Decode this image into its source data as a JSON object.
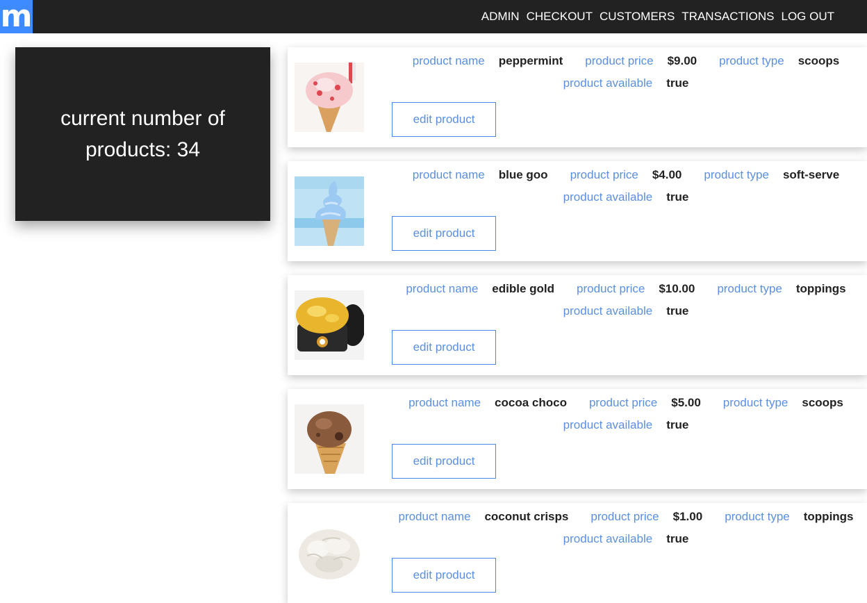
{
  "nav": {
    "logo": "m",
    "links": [
      "ADMIN",
      "CHECKOUT",
      "CUSTOMERS",
      "TRANSACTIONS",
      "LOG OUT"
    ]
  },
  "summary": {
    "text": "current number of products: 34"
  },
  "labels": {
    "name": "product name",
    "price": "product price",
    "type": "product type",
    "available": "product available",
    "edit": "edit product"
  },
  "products": [
    {
      "name": "peppermint",
      "price": "$9.00",
      "type": "scoops",
      "available": "true",
      "image": "peppermint-ice-cream"
    },
    {
      "name": "blue goo",
      "price": "$4.00",
      "type": "soft-serve",
      "available": "true",
      "image": "blue-soft-serve-cone"
    },
    {
      "name": "edible gold",
      "price": "$10.00",
      "type": "toppings",
      "available": "true",
      "image": "gold-flakes-jar"
    },
    {
      "name": "cocoa choco",
      "price": "$5.00",
      "type": "scoops",
      "available": "true",
      "image": "chocolate-ice-cream-cone"
    },
    {
      "name": "coconut crisps",
      "price": "$1.00",
      "type": "toppings",
      "available": "true",
      "image": "coconut-flakes"
    }
  ],
  "colors": {
    "nav_bg": "#222222",
    "logo_bg": "#3d8bff",
    "label": "#5b8fe0",
    "button_border": "#4a86e8"
  }
}
